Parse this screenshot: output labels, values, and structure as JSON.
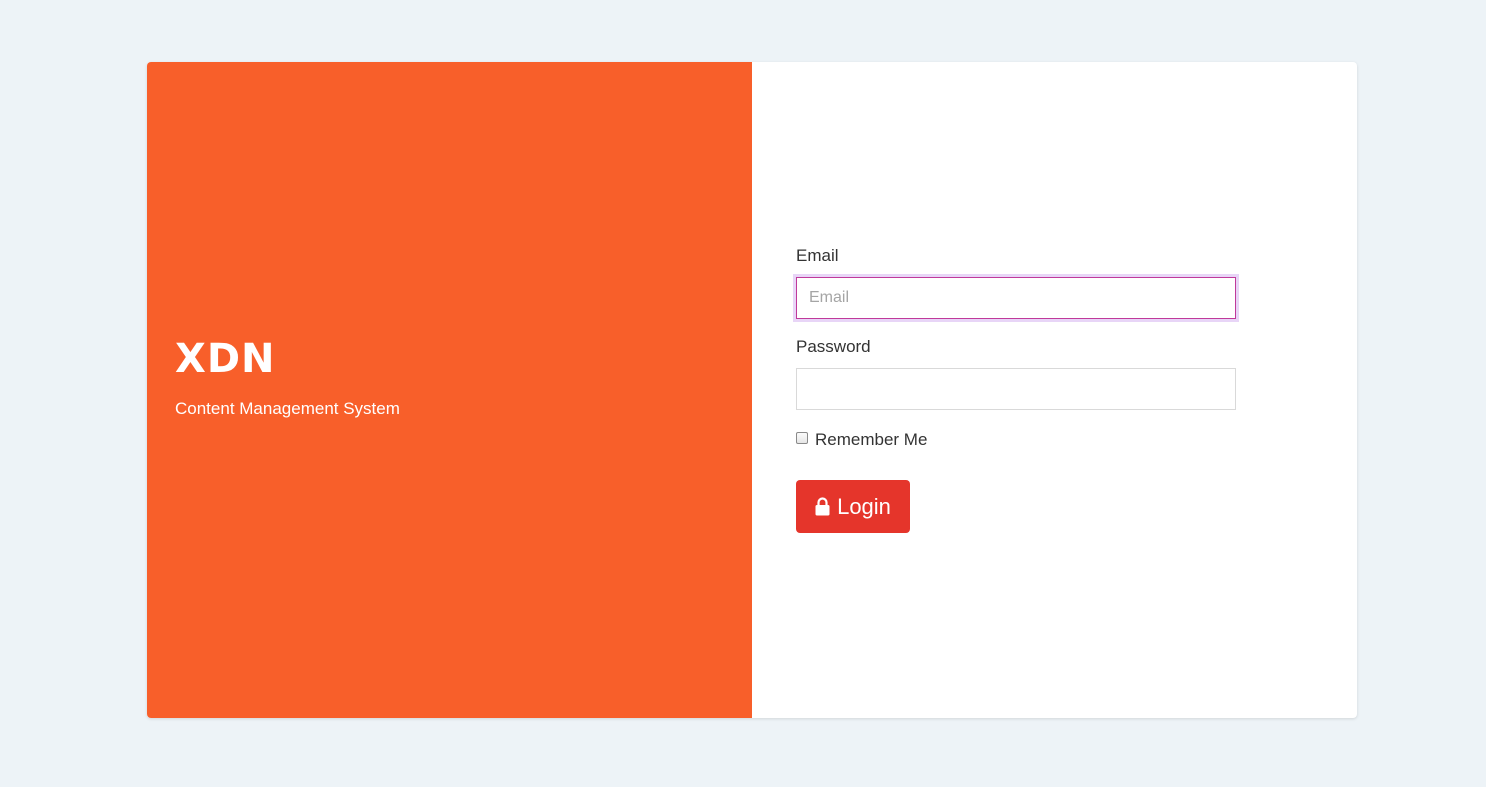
{
  "brand": {
    "title": "XDN",
    "subtitle": "Content Management System",
    "accent_color": "#f85f2a"
  },
  "form": {
    "email": {
      "label": "Email",
      "placeholder": "Email",
      "value": ""
    },
    "password": {
      "label": "Password",
      "placeholder": "",
      "value": ""
    },
    "remember": {
      "label": "Remember Me",
      "checked": false
    },
    "submit": {
      "label": "Login",
      "icon": "lock-icon",
      "color": "#e5352b"
    }
  }
}
